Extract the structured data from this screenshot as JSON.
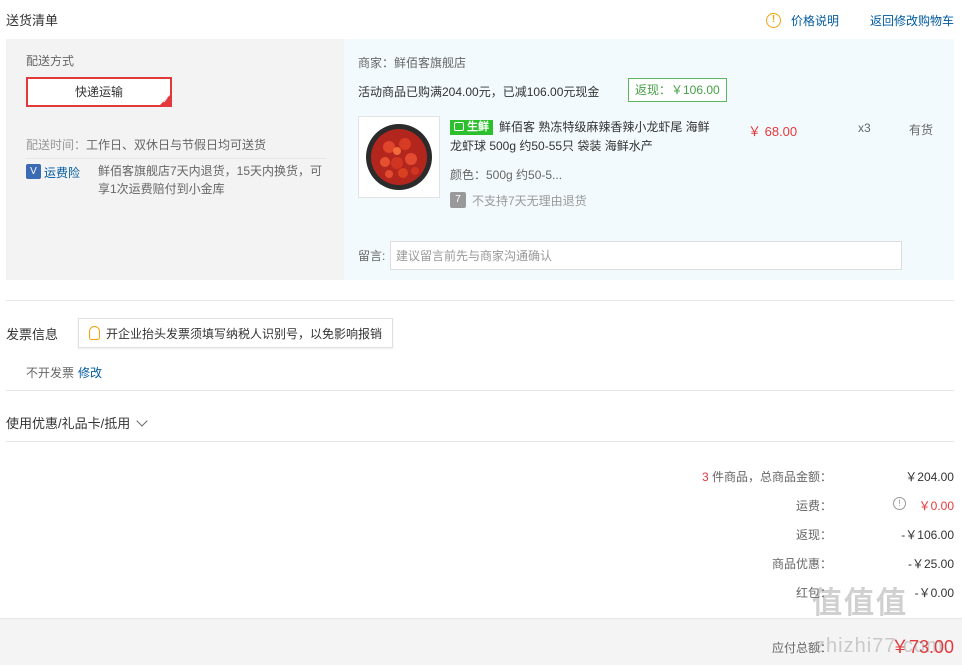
{
  "header": {
    "title": "送货清单",
    "price_explain": "价格说明",
    "back_to_cart": "返回修改购物车"
  },
  "shipping": {
    "method_label": "配送方式",
    "method_selected": "快递运输",
    "time_label": "配送时间：",
    "time_value": "工作日、双休日与节假日均可送货",
    "insurance_label": "运费险",
    "insurance_desc": "鲜佰客旗舰店7天内退货，15天内换货，可享1次运费赔付到小金库"
  },
  "order": {
    "seller": "商家：鲜佰客旗舰店",
    "promo_text": "活动商品已购满204.00元，已减106.00元现金",
    "promo_badge": "返现：￥106.00",
    "product": {
      "tag": "生鲜",
      "title": "鲜佰客 熟冻特级麻辣香辣小龙虾尾 海鲜龙虾球 500g 约50-55只 袋装 海鲜水产",
      "color": "颜色：500g 约50-5...",
      "no_return": "不支持7天无理由退货",
      "price": "￥ 68.00",
      "qty": "x3",
      "stock": "有货"
    },
    "note_label": "留言:",
    "note_placeholder": "建议留言前先与商家沟通确认"
  },
  "invoice": {
    "title": "发票信息",
    "tip": "开企业抬头发票须填写纳税人识别号，以免影响报销",
    "value": "不开发票",
    "edit": "修改"
  },
  "coupon": {
    "label": "使用优惠/礼品卡/抵用"
  },
  "summary": {
    "count": "3",
    "count_label": "件商品，总商品金额：",
    "total": "￥204.00",
    "shipping_label": "运费：",
    "shipping": "￥0.00",
    "cashback_label": "返现：",
    "cashback": "-￥106.00",
    "discount_label": "商品优惠：",
    "discount": "-￥25.00",
    "redpacket_label": "红包：",
    "redpacket": "-￥0.00",
    "pay_label": "应付总额：",
    "pay": "￥73.00"
  },
  "watermark": {
    "main": "值值值",
    "sub": "zhizhi77.com"
  },
  "colors": {
    "accent_red": "#e4393c",
    "link_blue": "#005aa0",
    "promo_green": "#46a046"
  }
}
